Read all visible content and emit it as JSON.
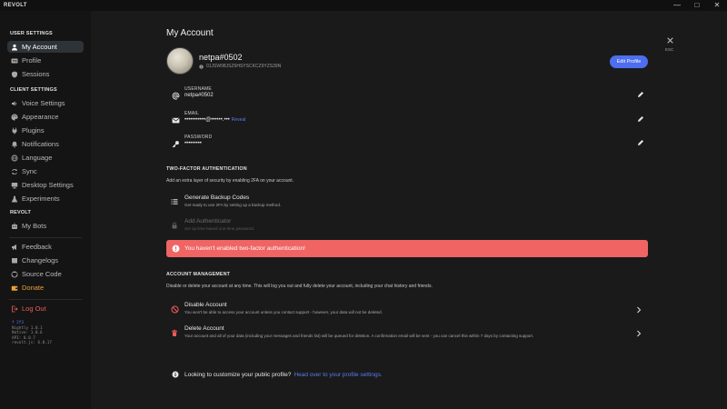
{
  "window": {
    "app_title": "REVOLT",
    "minimize_glyph": "—",
    "maximize_glyph": "□",
    "close_glyph": "✕"
  },
  "sidebar": {
    "user_settings_title": "USER SETTINGS",
    "client_settings_title": "CLIENT SETTINGS",
    "revolt_title": "REVOLT",
    "items": {
      "my_account": "My Account",
      "profile": "Profile",
      "sessions": "Sessions",
      "voice_settings": "Voice Settings",
      "appearance": "Appearance",
      "plugins": "Plugins",
      "notifications": "Notifications",
      "language": "Language",
      "sync": "Sync",
      "desktop_settings": "Desktop Settings",
      "experiments": "Experiments",
      "my_bots": "My Bots",
      "feedback": "Feedback",
      "changelogs": "Changelogs",
      "source_code": "Source Code",
      "donate": "Donate",
      "log_out": "Log Out"
    },
    "versions": {
      "hash": "f 2f3",
      "nightly": "Nightly 1.0.1",
      "native": "Native: 1.0.6",
      "api": "API: 0.0.7",
      "revolt_js": "revolt.js: 6.0.17"
    }
  },
  "account": {
    "heading": "My Account",
    "username_display": "netpa#0502",
    "user_id": "01JSW98JSZ6HSYSCKCZ9YZS39N",
    "edit_profile_label": "Edit Profile",
    "esc_label": "ESC",
    "fields": {
      "username": {
        "label": "USERNAME",
        "value": "netpa#0502"
      },
      "email": {
        "label": "EMAIL",
        "value": "•••••••••••@••••••.•••",
        "reveal": "Reveal"
      },
      "password": {
        "label": "PASSWORD",
        "value": "•••••••••"
      }
    }
  },
  "two_factor": {
    "title": "TWO-FACTOR AUTHENTICATION",
    "description": "Add an extra layer of security by enabling 2FA on your account.",
    "backup_codes_title": "Generate Backup Codes",
    "backup_codes_sub": "Get ready to use 2FA by setting up a backup method.",
    "authenticator_title": "Add Authenticator",
    "authenticator_sub": "Set up time-based one-time password.",
    "warning": "You haven't enabled two-factor authentication!"
  },
  "account_management": {
    "title": "ACCOUNT MANAGEMENT",
    "description": "Disable or delete your account at any time. This will log you out and fully delete your account, including your chat history and friends.",
    "disable_title": "Disable Account",
    "disable_sub": "You won't be able to access your account unless you contact support - however, your data will not be deleted.",
    "delete_title": "Delete Account",
    "delete_sub": "Your account and all of your data (including your messages and friends list) will be queued for deletion. A confirmation email will be sent - you can cancel this within 7 days by contacting support."
  },
  "tip": {
    "text": "Looking to customize your public profile?",
    "link": "Head over to your profile settings."
  },
  "colors": {
    "accent": "#4d6ef0",
    "danger": "#f06464",
    "donate": "#e8a23a",
    "logout": "#ef5a5a",
    "active_item": "#2e3338"
  }
}
